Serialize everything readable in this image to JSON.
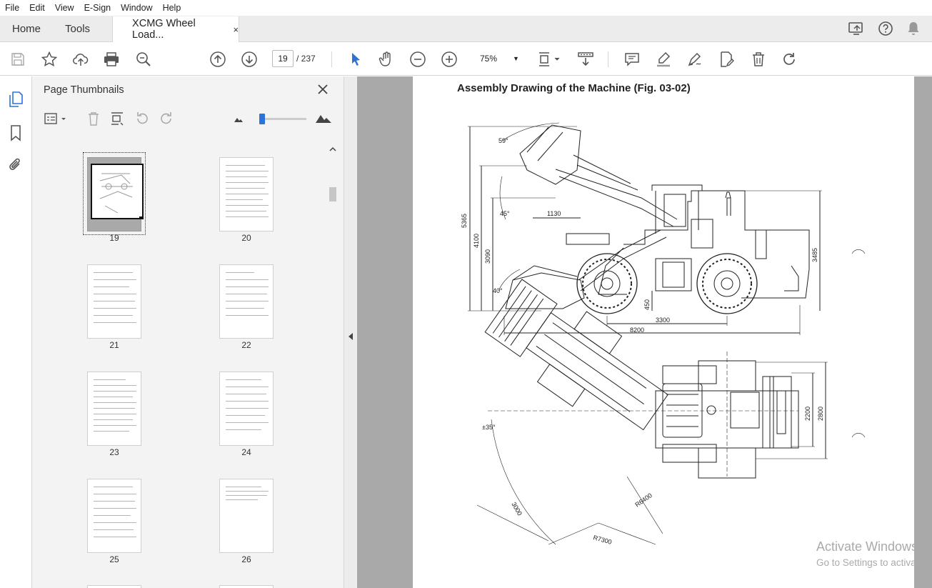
{
  "menu": [
    "File",
    "Edit",
    "View",
    "E-Sign",
    "Window",
    "Help"
  ],
  "tabs": {
    "home": "Home",
    "tools": "Tools",
    "document": "XCMG Wheel Load...",
    "close": "×"
  },
  "toolbar": {
    "current_page": "19",
    "page_total": "/  237",
    "zoom": "75%"
  },
  "thumbnails_panel": {
    "title": "Page Thumbnails",
    "pages": [
      "19",
      "20",
      "21",
      "22",
      "23",
      "24",
      "25",
      "26"
    ],
    "selected_page": "19"
  },
  "document": {
    "title": "Assembly Drawing of the Machine (Fig. 03-02)",
    "dimensions": {
      "side_view": [
        "59°",
        "5365",
        "4100",
        "45°",
        "1130",
        "3090",
        "40°",
        "450",
        "3300",
        "8200",
        "3485"
      ],
      "top_view": [
        "±35°",
        "2200",
        "2800",
        "3000",
        "R6400",
        "R7300"
      ]
    }
  },
  "watermark": {
    "line1": "Activate Windows",
    "line2": "Go to Settings to activate Windows."
  },
  "colors": {
    "accent": "#2b73d9",
    "doc_background": "#a9a9a9",
    "panel_background": "#f3f3f3"
  }
}
